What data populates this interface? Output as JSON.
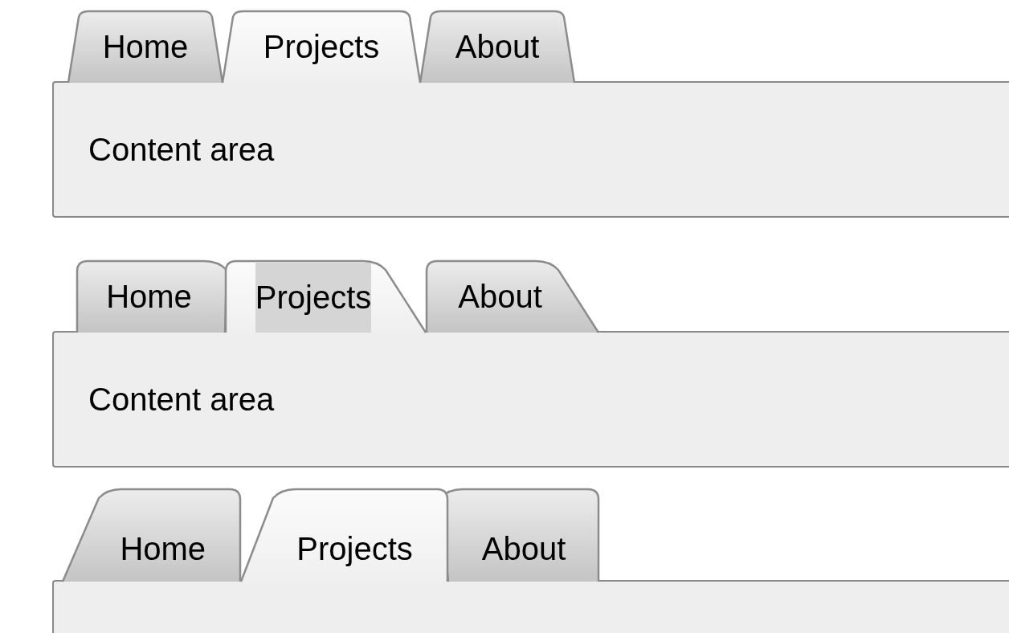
{
  "groups": [
    {
      "kind": "trapezoid",
      "tabs": [
        {
          "label": "Home",
          "selected": false
        },
        {
          "label": "Projects",
          "selected": true
        },
        {
          "label": "About",
          "selected": false
        }
      ],
      "panel": {
        "text": "Content area"
      }
    },
    {
      "kind": "slantright",
      "tabs": [
        {
          "label": "Home",
          "selected": false,
          "highlighted": false
        },
        {
          "label": "Projects",
          "selected": true,
          "highlighted": true
        },
        {
          "label": "About",
          "selected": false,
          "highlighted": false
        }
      ],
      "panel": {
        "text": "Content area"
      }
    },
    {
      "kind": "slantleft",
      "tabs": [
        {
          "label": "Home",
          "selected": false
        },
        {
          "label": "Projects",
          "selected": true
        },
        {
          "label": "About",
          "selected": false
        }
      ]
    }
  ]
}
